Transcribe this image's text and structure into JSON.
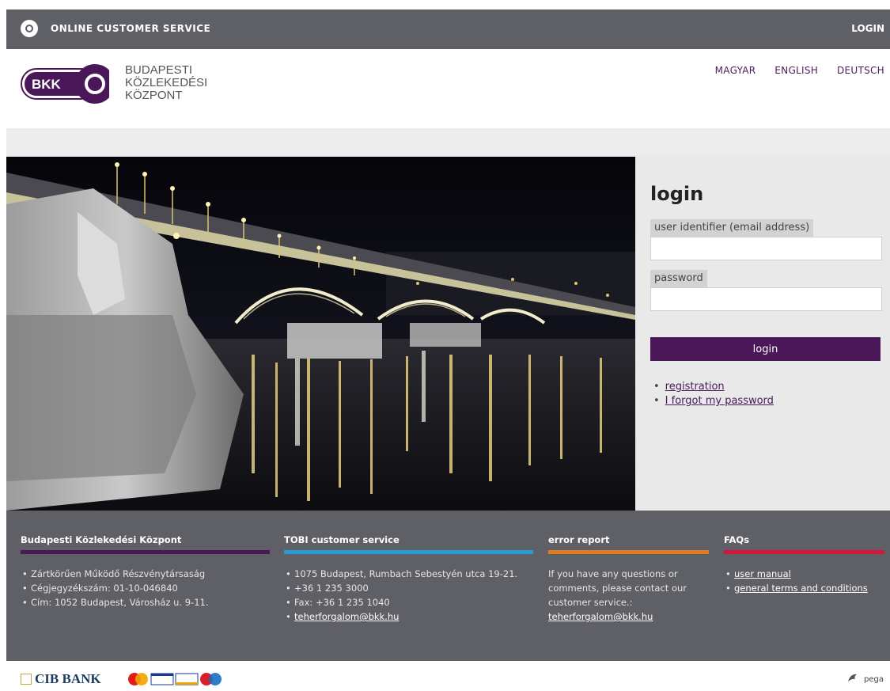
{
  "topbar": {
    "title": "ONLINE CUSTOMER SERVICE",
    "login_link": "LOGIN"
  },
  "header": {
    "logo_abbr": "BKK",
    "logo_lines": [
      "BUDAPESTI",
      "KÖZLEKEDÉSI",
      "KÖZPONT"
    ],
    "languages": [
      "MAGYAR",
      "ENGLISH",
      "DEUTSCH"
    ]
  },
  "login": {
    "title": "login",
    "user_label": "user identifier (email address)",
    "user_value": "",
    "password_label": "password",
    "password_value": "",
    "button_label": "login",
    "links": [
      "registration",
      "I forgot my password"
    ]
  },
  "footer": {
    "col1": {
      "title": "Budapesti Közlekedési Központ",
      "items": [
        "Zártkörűen Működő Részvénytársaság",
        "Cégjegyzékszám: 01-10-046840",
        "Cím: 1052 Budapest, Városház u. 9-11."
      ],
      "accent": "#4a1758"
    },
    "col2": {
      "title": "TOBI customer service",
      "items": [
        "1075 Budapest, Rumbach Sebestyén utca 19-21.",
        "+36 1 235 3000",
        "Fax: +36 1 235 1040"
      ],
      "email": "teherforgalom@bkk.hu",
      "accent": "#2a9ad6"
    },
    "col3": {
      "title": "error report",
      "text": "If you have any questions or comments, please contact our customer service.:",
      "email": "teherforgalom@bkk.hu",
      "accent": "#e07a1f"
    },
    "col4": {
      "title": "FAQs",
      "links": [
        "user manual",
        "general terms and conditions"
      ],
      "accent": "#d4163f"
    }
  },
  "bottom": {
    "bank_name": "CIB BANK",
    "vendor": "pega"
  }
}
